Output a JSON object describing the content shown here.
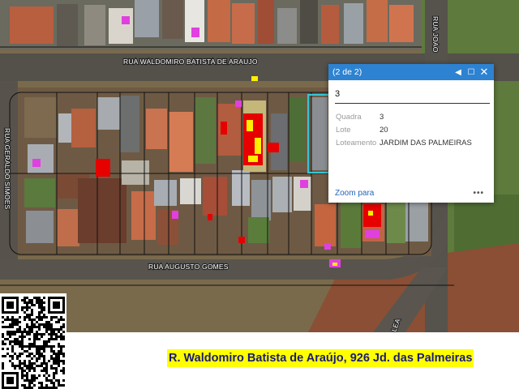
{
  "streets": {
    "north": "RUA WALDOMIRO BATISTA DE ARAUJO",
    "west": "RUA GERALDO SIMOES",
    "south": "RUA AUGUSTO GOMES",
    "east": "RUA JOAO",
    "southeast": "LEA"
  },
  "popup": {
    "counter": "(2 de 2)",
    "prev_icon": "triangle-left-icon",
    "maximize_icon": "square-icon",
    "close_icon": "x-icon",
    "title": "3",
    "fields": [
      {
        "key": "Quadra",
        "value": "3"
      },
      {
        "key": "Lote",
        "value": "20"
      },
      {
        "key": "Loteamento",
        "value": "JARDIM DAS PALMEIRAS"
      }
    ],
    "zoom_link": "Zoom para",
    "more_icon": "ellipsis-icon"
  },
  "caption": "R. Waldomiro Batista de Araújo, 926 Jd. das Palmeiras",
  "colors": {
    "popup_header": "#2d83d2",
    "caption_bg": "#ffff00",
    "caption_text": "#1a1a7a",
    "highlight_outline": "#35c6d6",
    "heat_red": "#e60000",
    "heat_yellow": "#ffee00",
    "heat_magenta": "#e040e0"
  }
}
